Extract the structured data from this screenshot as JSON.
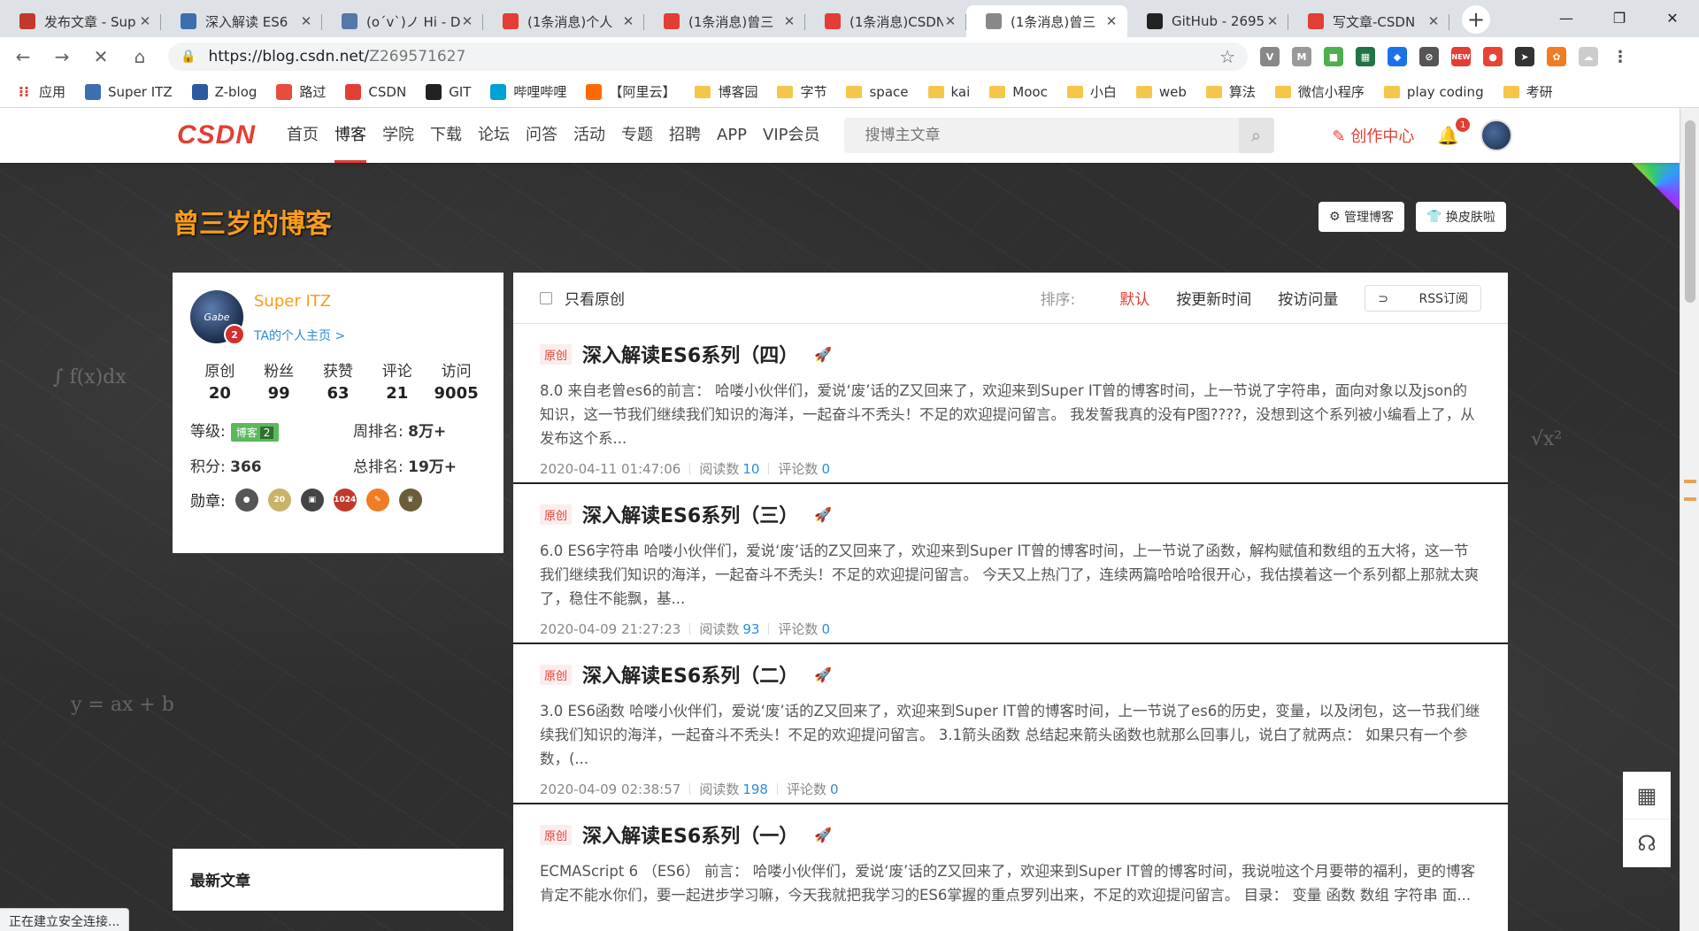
{
  "tabs": [
    {
      "title": "发布文章 - Sup",
      "color": "#c0392b",
      "icon": "csdn-publish-icon"
    },
    {
      "title": "深入解读 ES6",
      "color": "#3b6fb0",
      "icon": "avatar-icon"
    },
    {
      "title": "(o´v`)ノ Hi - D",
      "color": "#5577aa",
      "icon": "blog-icon"
    },
    {
      "title": "(1条消息)个人",
      "color": "#e33e33",
      "icon": "csdn-icon"
    },
    {
      "title": "(1条消息)曾三",
      "color": "#e33e33",
      "icon": "csdn-icon"
    },
    {
      "title": "(1条消息)CSDN",
      "color": "#e33e33",
      "icon": "csdn-icon"
    },
    {
      "title": "(1条消息)曾三",
      "color": "#888888",
      "icon": "loading-icon",
      "active": true
    },
    {
      "title": "GitHub - 2695",
      "color": "#222222",
      "icon": "github-icon"
    },
    {
      "title": "写文章-CSDN",
      "color": "#e33e33",
      "icon": "csdn-icon"
    }
  ],
  "address": {
    "host": "https://blog.csdn.net/",
    "path": "Z269571627"
  },
  "bookmarks": [
    {
      "label": "应用",
      "type": "apps"
    },
    {
      "label": "Super ITZ",
      "type": "site",
      "color": "#3b6fb0"
    },
    {
      "label": "Z-blog",
      "type": "site",
      "color": "#2b5aa0"
    },
    {
      "label": "路过",
      "type": "site",
      "color": "#e74c3c"
    },
    {
      "label": "CSDN",
      "type": "site",
      "color": "#e33e33"
    },
    {
      "label": "GIT",
      "type": "site",
      "color": "#222222"
    },
    {
      "label": "哔哩哔哩",
      "type": "site",
      "color": "#00a1d6"
    },
    {
      "label": "【阿里云】",
      "type": "site",
      "color": "#ff6a00"
    },
    {
      "label": "博客园",
      "type": "folder"
    },
    {
      "label": "字节",
      "type": "folder"
    },
    {
      "label": "space",
      "type": "folder"
    },
    {
      "label": "kai",
      "type": "folder"
    },
    {
      "label": "Mooc",
      "type": "folder"
    },
    {
      "label": "小白",
      "type": "folder"
    },
    {
      "label": "web",
      "type": "folder"
    },
    {
      "label": "算法",
      "type": "folder"
    },
    {
      "label": "微信小程序",
      "type": "folder"
    },
    {
      "label": "play coding",
      "type": "folder"
    },
    {
      "label": "考研",
      "type": "folder"
    }
  ],
  "csdn": {
    "logo": "CSDN",
    "nav": [
      "首页",
      "博客",
      "学院",
      "下载",
      "论坛",
      "问答",
      "活动",
      "专题",
      "招聘",
      "APP",
      "VIP会员"
    ],
    "active_nav": "博客",
    "search_placeholder": "搜博主文章",
    "create": "创作中心",
    "notify_count": "1"
  },
  "blog": {
    "title": "曾三岁的博客",
    "manage_btn": "管理博客",
    "skin_btn": "换皮肤啦"
  },
  "profile": {
    "name": "Super ITZ",
    "home_link": "TA的个人主页 >",
    "avatar_text": "Gabe",
    "years": "2",
    "stats": [
      {
        "label": "原创",
        "value": "20"
      },
      {
        "label": "粉丝",
        "value": "99"
      },
      {
        "label": "获赞",
        "value": "63"
      },
      {
        "label": "评论",
        "value": "21"
      },
      {
        "label": "访问",
        "value": "9005"
      }
    ],
    "level_label": "等级:",
    "level_badge": "博客",
    "level_num": "2",
    "week_rank_label": "周排名:",
    "week_rank": "8万+",
    "points_label": "积分:",
    "points": "366",
    "total_rank_label": "总排名:",
    "total_rank": "19万+",
    "medals_label": "勋章:",
    "latest_label": "最新文章"
  },
  "filter": {
    "only_original": "只看原创",
    "sort_label": "排序:",
    "default": "默认",
    "by_update": "按更新时间",
    "by_views": "按访问量",
    "rss": "RSS订阅"
  },
  "articles": [
    {
      "tag": "原创",
      "title": "深入解读ES6系列（四）",
      "desc": "8.0 来自老曾es6的前言： 哈喽小伙伴们，爱说‘废’话的Z又回来了，欢迎来到Super IT曾的博客时间，上一节说了字符串，面向对象以及json的知识，这一节我们继续我们知识的海洋，一起奋斗不秃头！不足的欢迎提问留言。 我发誓我真的没有P图????，没想到这个系列被小编看上了，从发布这个系...",
      "date": "2020-04-11 01:47:06",
      "reads_label": "阅读数",
      "reads": "10",
      "comments_label": "评论数",
      "comments": "0"
    },
    {
      "tag": "原创",
      "title": "深入解读ES6系列（三）",
      "desc": "6.0 ES6字符串 哈喽小伙伴们，爱说‘废’话的Z又回来了，欢迎来到Super IT曾的博客时间，上一节说了函数，解构赋值和数组的五大将，这一节我们继续我们知识的海洋，一起奋斗不秃头！不足的欢迎提问留言。 今天又上热门了，连续两篇哈哈哈很开心，我估摸着这一个系列都上那就太爽了，稳住不能飘，基...",
      "date": "2020-04-09 21:27:23",
      "reads_label": "阅读数",
      "reads": "93",
      "comments_label": "评论数",
      "comments": "0"
    },
    {
      "tag": "原创",
      "title": "深入解读ES6系列（二）",
      "desc": "3.0 ES6函数 哈喽小伙伴们，爱说‘废’话的Z又回来了，欢迎来到Super IT曾的博客时间，上一节说了es6的历史，变量，以及闭包，这一节我们继续我们知识的海洋，一起奋斗不秃头！不足的欢迎提问留言。 3.1箭头函数 总结起来箭头函数也就那么回事儿，说白了就两点： 如果只有一个参数，(...",
      "date": "2020-04-09 02:38:57",
      "reads_label": "阅读数",
      "reads": "198",
      "comments_label": "评论数",
      "comments": "0"
    },
    {
      "tag": "原创",
      "title": "深入解读ES6系列（一）",
      "desc": "ECMAScript 6 （ES6） 前言： 哈喽小伙伴们，爱说‘废’话的Z又回来了，欢迎来到Super IT曾的博客时间，我说啦这个月要带的福利，更的博客肯定不能水你们，要一起进步学习嘛，今天我就把我学习的ES6掌握的重点罗列出来，不足的欢迎提问留言。 目录： 变量 函数 数组 字符串 面...",
      "date": "",
      "reads_label": "",
      "reads": "",
      "comments_label": "",
      "comments": ""
    }
  ],
  "status": "正在建立安全连接..."
}
